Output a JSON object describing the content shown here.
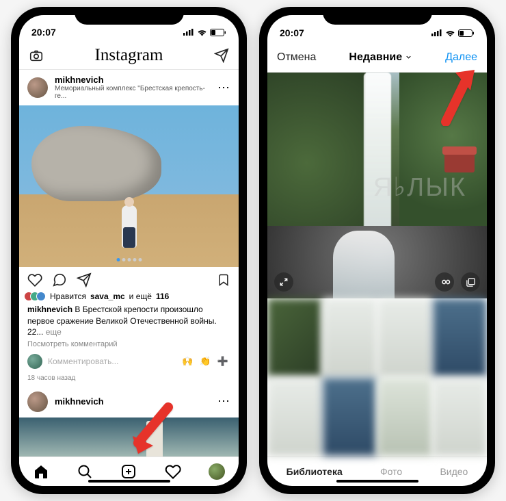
{
  "status": {
    "time": "20:07"
  },
  "screen1": {
    "app_title": "Instagram",
    "post": {
      "username": "mikhnevich",
      "location": "Мемориальный комплекс \"Брестская крепость-ге...",
      "likes_prefix": "Нравится",
      "likes_user": "sava_mc",
      "likes_and": "и ещё",
      "likes_count": "116",
      "caption_user": "mikhnevich",
      "caption_text": "В Брестской крепости произошло первое сражение Великой Отечественной войны. 22...",
      "more": "еще",
      "view_comments": "Посмотреть комментарий",
      "comment_placeholder": "Комментировать...",
      "emoji": "🙌 👏 ➕",
      "timestamp": "18 часов назад"
    },
    "post2": {
      "username": "mikhnevich"
    }
  },
  "screen2": {
    "cancel": "Отмена",
    "recents": "Недавние",
    "next": "Далее",
    "tabs": {
      "library": "Библиотека",
      "photo": "Фото",
      "video": "Видео"
    }
  },
  "icons": {
    "camera": "camera-icon",
    "dm": "paper-plane-icon",
    "heart": "heart-icon",
    "comment": "comment-icon",
    "share": "share-icon",
    "bookmark": "bookmark-icon",
    "home": "home-icon",
    "search": "search-icon",
    "add": "add-post-icon",
    "activity": "activity-icon",
    "profile": "profile-icon",
    "chevron": "chevron-down-icon",
    "expand": "expand-icon",
    "infinity": "infinity-icon",
    "multiselect": "multi-select-icon"
  }
}
